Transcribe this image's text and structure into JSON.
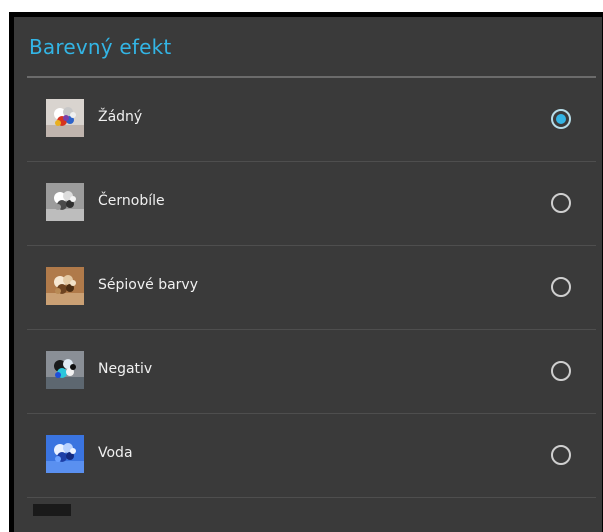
{
  "dialog": {
    "title": "Barevný efekt",
    "accent_color": "#33b5e5",
    "options": [
      {
        "label": "Žádný",
        "selected": true,
        "thumbnail": "color-effect-none-thumbnail"
      },
      {
        "label": "Černobíle",
        "selected": false,
        "thumbnail": "color-effect-mono-thumbnail"
      },
      {
        "label": "Sépiové barvy",
        "selected": false,
        "thumbnail": "color-effect-sepia-thumbnail"
      },
      {
        "label": "Negativ",
        "selected": false,
        "thumbnail": "color-effect-negative-thumbnail"
      },
      {
        "label": "Voda",
        "selected": false,
        "thumbnail": "color-effect-aqua-thumbnail"
      }
    ]
  }
}
